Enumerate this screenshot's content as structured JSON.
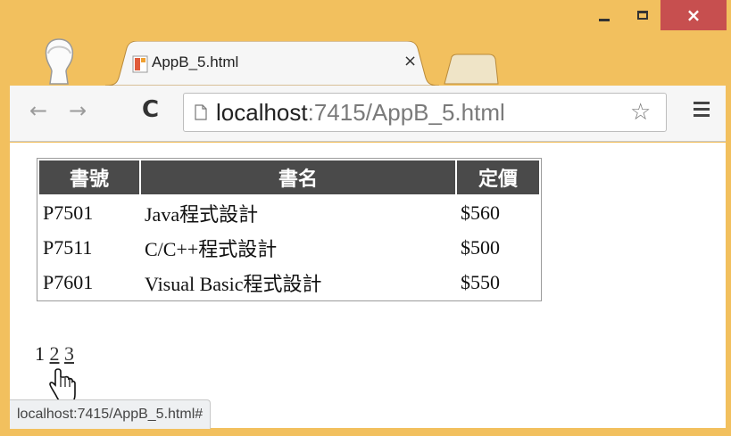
{
  "window": {
    "close_glyph": "×"
  },
  "tab": {
    "title": "AppB_5.html",
    "close_glyph": "×"
  },
  "toolbar": {
    "back_glyph": "←",
    "forward_glyph": "→",
    "reload_glyph": "C",
    "url_host": "localhost",
    "url_rest": ":7415/AppB_5.html",
    "star_glyph": "☆"
  },
  "table": {
    "headers": [
      "書號",
      "書名",
      "定價"
    ],
    "rows": [
      [
        "P7501",
        "Java程式設計",
        "$560"
      ],
      [
        "P7511",
        "C/C++程式設計",
        "$500"
      ],
      [
        "P7601",
        "Visual Basic程式設計",
        "$550"
      ]
    ]
  },
  "pager": {
    "current": "1",
    "links": [
      "2",
      "3"
    ]
  },
  "status": {
    "text": "localhost:7415/AppB_5.html#"
  },
  "colors": {
    "frame": "#f2c05e",
    "close": "#c74f4f",
    "header_bg": "#4a4a4a"
  }
}
